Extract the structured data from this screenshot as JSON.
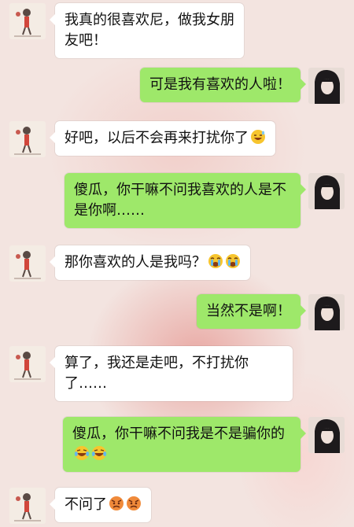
{
  "messages": [
    {
      "side": "in",
      "text": "我真的很喜欢尼，做我女朋友吧！",
      "emoji": []
    },
    {
      "side": "out",
      "text": "可是我有喜欢的人啦！",
      "emoji": []
    },
    {
      "side": "in",
      "text": "好吧，以后不会再来打扰你了",
      "emoji": [
        "grinning-sweat-emoji"
      ]
    },
    {
      "side": "out",
      "text": "傻瓜，你干嘛不问我喜欢的人是不是你啊……",
      "emoji": []
    },
    {
      "side": "in",
      "text": "那你喜欢的人是我吗？",
      "emoji": [
        "crying-face-emoji",
        "crying-face-emoji"
      ]
    },
    {
      "side": "out",
      "text": "当然不是啊！",
      "emoji": []
    },
    {
      "side": "in",
      "text": "算了，我还是走吧，不打扰你了……",
      "emoji": []
    },
    {
      "side": "out",
      "text": "傻瓜，你干嘛不问我是不是骗你的",
      "emoji": [
        "laughing-tears-emoji",
        "laughing-tears-emoji"
      ]
    },
    {
      "side": "in",
      "text": "不问了",
      "emoji": [
        "angry-face-emoji",
        "angry-face-emoji"
      ]
    }
  ],
  "colors": {
    "bubble_out": "#9ee86a",
    "bubble_in": "#ffffff",
    "background": "#f3e4e0"
  }
}
